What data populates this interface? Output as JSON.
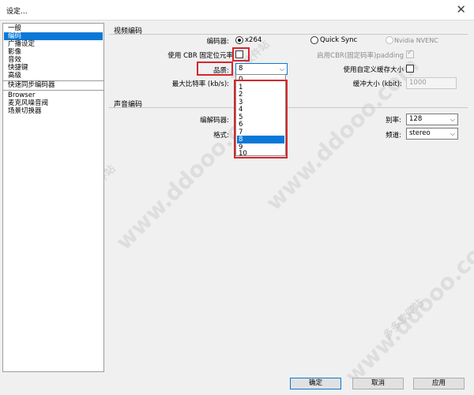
{
  "window": {
    "title": "设定...",
    "close_glyph": "✕"
  },
  "sidebar": {
    "items_group1": [
      "一般",
      "编码",
      "广播设定",
      "影像",
      "音效",
      "快捷键",
      "高级"
    ],
    "items_group2": [
      "快速同步编码器"
    ],
    "items_group3": [
      "Browser",
      "麦克风噪音阀",
      "场景切换器"
    ]
  },
  "video": {
    "section_title": "视频编码",
    "encoder_label": "编码器:",
    "encoder_options": [
      "x264",
      "Quick Sync",
      "Nvidia NVENC"
    ],
    "cbr_label": "使用 CBR 固定位元率",
    "cbr_padding_label": "启用CBR(固定码率)padding",
    "cbr_padding_mark": "✓",
    "quality_label": "品质:",
    "quality_value": "8",
    "quality_options": [
      "0",
      "1",
      "2",
      "3",
      "4",
      "5",
      "6",
      "7",
      "8",
      "9",
      "10"
    ],
    "buffer_custom_label": "使用自定义缓存大小",
    "max_bitrate_label": "最大比特率 (kb/s):",
    "buffer_size_label": "缓冲大小 (kbit):",
    "buffer_size_value": "1000"
  },
  "audio": {
    "section_title": "声音编码",
    "codec_label": "编解码器:",
    "format_label": "格式:",
    "bitrate_label": "别率:",
    "bitrate_value": "128",
    "channel_label": "频道:",
    "channel_value": "stereo"
  },
  "footer": {
    "ok_label": "确定",
    "cancel_label": "取消",
    "apply_label": "应用"
  },
  "watermarks": [
    "www.ddooo.com",
    "多多软件站"
  ],
  "colors": {
    "selection": "#0a78d7",
    "highlight_box": "#d7262c"
  }
}
